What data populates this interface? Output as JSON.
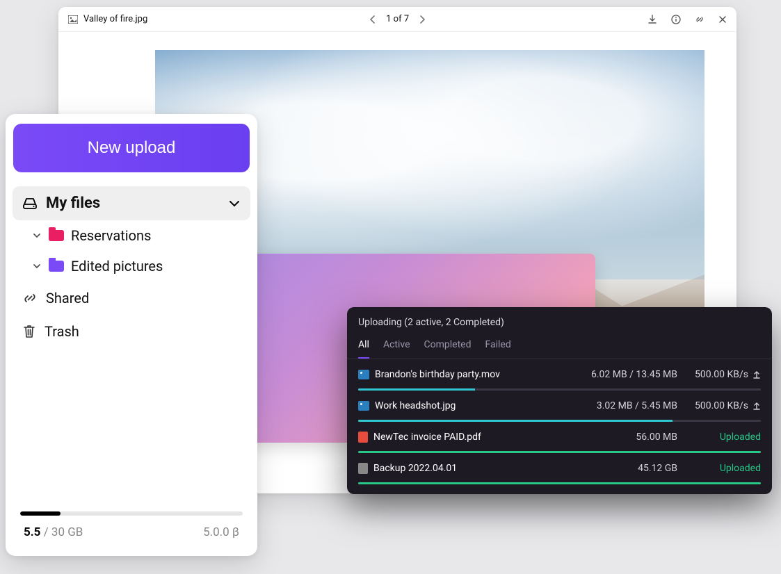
{
  "viewer": {
    "filename": "Valley of fire.jpg",
    "page_current": "1",
    "page_total": "7",
    "pager_text": "1 of 7"
  },
  "sidebar": {
    "upload_button": "New upload",
    "my_files": "My files",
    "items": [
      {
        "label": "Reservations"
      },
      {
        "label": "Edited pictures"
      }
    ],
    "shared": "Shared",
    "trash": "Trash",
    "storage": {
      "used": "5.5",
      "total": "/ 30 GB",
      "percent": 18,
      "version": "5.0.0 β"
    }
  },
  "uploads": {
    "header": "Uploading (2 active, 2 Completed)",
    "tabs": {
      "all": "All",
      "active": "Active",
      "completed": "Completed",
      "failed": "Failed"
    },
    "rows": [
      {
        "name": "Brandon's birthday party.mov",
        "size": "6.02 MB / 13.45 MB",
        "speed": "500.00 KB/s",
        "percent": 29,
        "status": "uploading"
      },
      {
        "name": "Work headshot.jpg",
        "size": "3.02 MB / 5.45 MB",
        "speed": "500.00 KB/s",
        "percent": 78,
        "status": "uploading"
      },
      {
        "name": "NewTec invoice PAID.pdf",
        "size": "56.00 MB",
        "status_label": "Uploaded",
        "percent": 100,
        "status": "done"
      },
      {
        "name": "Backup 2022.04.01",
        "size": "45.12 GB",
        "status_label": "Uploaded",
        "percent": 100,
        "status": "done"
      }
    ]
  }
}
